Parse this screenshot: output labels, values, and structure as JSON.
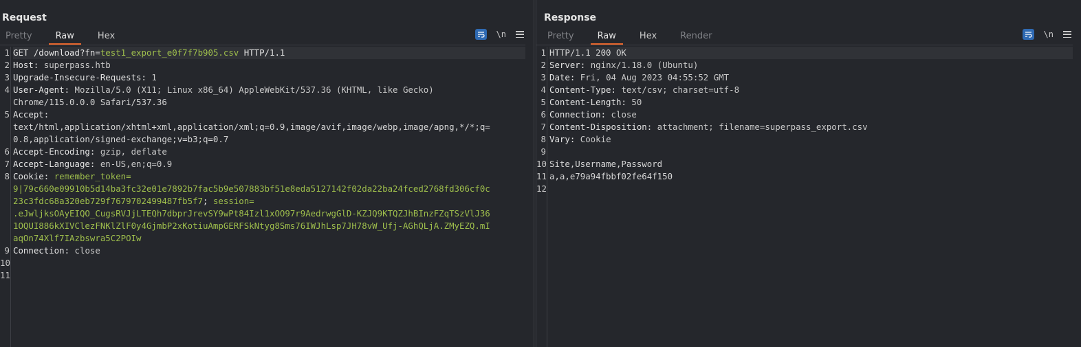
{
  "request": {
    "title": "Request",
    "tabs": [
      "Pretty",
      "Raw",
      "Hex"
    ],
    "active_tab": "Raw",
    "tools": {
      "wrap_icon": "wrap-icon",
      "newline_label": "\\n",
      "menu_icon": "menu-icon"
    },
    "lines": [
      {
        "n": "1",
        "t": "GET /download?fn=test1_export_e0f7f7b905.csv HTTP/1.1"
      },
      {
        "n": "2",
        "k": "Host",
        "v": "superpass.htb"
      },
      {
        "n": "3",
        "k": "Upgrade-Insecure-Requests",
        "v": "1"
      },
      {
        "n": "4",
        "k": "User-Agent",
        "v": "Mozilla/5.0 (X11; Linux x86_64) AppleWebKit/537.36 (KHTML, like Gecko)"
      },
      {
        "n": "",
        "t": "Chrome/115.0.0.0 Safari/537.36"
      },
      {
        "n": "5",
        "k": "Accept",
        "v": ""
      },
      {
        "n": "",
        "t": "text/html,application/xhtml+xml,application/xml;q=0.9,image/avif,image/webp,image/apng,*/*;q="
      },
      {
        "n": "",
        "t": "0.8,application/signed-exchange;v=b3;q=0.7"
      },
      {
        "n": "6",
        "k": "Accept-Encoding",
        "v": "gzip, deflate"
      },
      {
        "n": "7",
        "k": "Accept-Language",
        "v": "en-US,en;q=0.9"
      },
      {
        "n": "8",
        "k": "Cookie",
        "v": "remember_token="
      },
      {
        "n": "",
        "p": "9|79c660e09910b5d14ba3fc32e01e7892b7fac5b9e507883bf51e8eda5127142f02da22ba24fced2768fd306cf0c"
      },
      {
        "n": "",
        "p": "23c3fdc68a320eb729f7679702499487fb5f7; session="
      },
      {
        "n": "",
        "p": ".eJwljksOAyEIQO_CugsRVJjLTEQh7dbprJrevSY9wPt84Izl1xOO97r9AedrwgGlD-KZJQ9KTQZJhBInzFZqTSzVlJ36"
      },
      {
        "n": "",
        "p": "1OQUI886kXIVClezFNKlZlF0y4GjmbP2xKotiuAmpGERFSkNtyg8Sms76IWJhLsp7JH78vW_Ufj-AGhQLjA.ZMyEZQ.mI"
      },
      {
        "n": "",
        "p": "aqOn74Xlf7IAzbswra5C2POIw"
      },
      {
        "n": "9",
        "k": "Connection",
        "v": "close"
      },
      {
        "n": "10",
        "t": ""
      },
      {
        "n": "11",
        "t": ""
      }
    ]
  },
  "response": {
    "title": "Response",
    "tabs": [
      "Pretty",
      "Raw",
      "Hex",
      "Render"
    ],
    "active_tab": "Raw",
    "tools": {
      "wrap_icon": "wrap-icon",
      "newline_label": "\\n",
      "menu_icon": "menu-icon"
    },
    "lines": [
      {
        "n": "1",
        "t": "HTTP/1.1 200 OK"
      },
      {
        "n": "2",
        "k": "Server",
        "v": "nginx/1.18.0 (Ubuntu)"
      },
      {
        "n": "3",
        "k": "Date",
        "v": "Fri, 04 Aug 2023 04:55:52 GMT"
      },
      {
        "n": "4",
        "k": "Content-Type",
        "v": "text/csv; charset=utf-8"
      },
      {
        "n": "5",
        "k": "Content-Length",
        "v": "50"
      },
      {
        "n": "6",
        "k": "Connection",
        "v": "close"
      },
      {
        "n": "7",
        "k": "Content-Disposition",
        "v": "attachment; filename=superpass_export.csv"
      },
      {
        "n": "8",
        "k": "Vary",
        "v": "Cookie"
      },
      {
        "n": "9",
        "t": ""
      },
      {
        "n": "10",
        "t": "Site,Username,Password"
      },
      {
        "n": "11",
        "t": "a,a,e79a94fbbf02fe64f150"
      },
      {
        "n": "12",
        "t": ""
      }
    ]
  },
  "layout_buttons": [
    "side-by-side-layout-icon",
    "stacked-layout-icon",
    "single-pane-layout-icon"
  ]
}
